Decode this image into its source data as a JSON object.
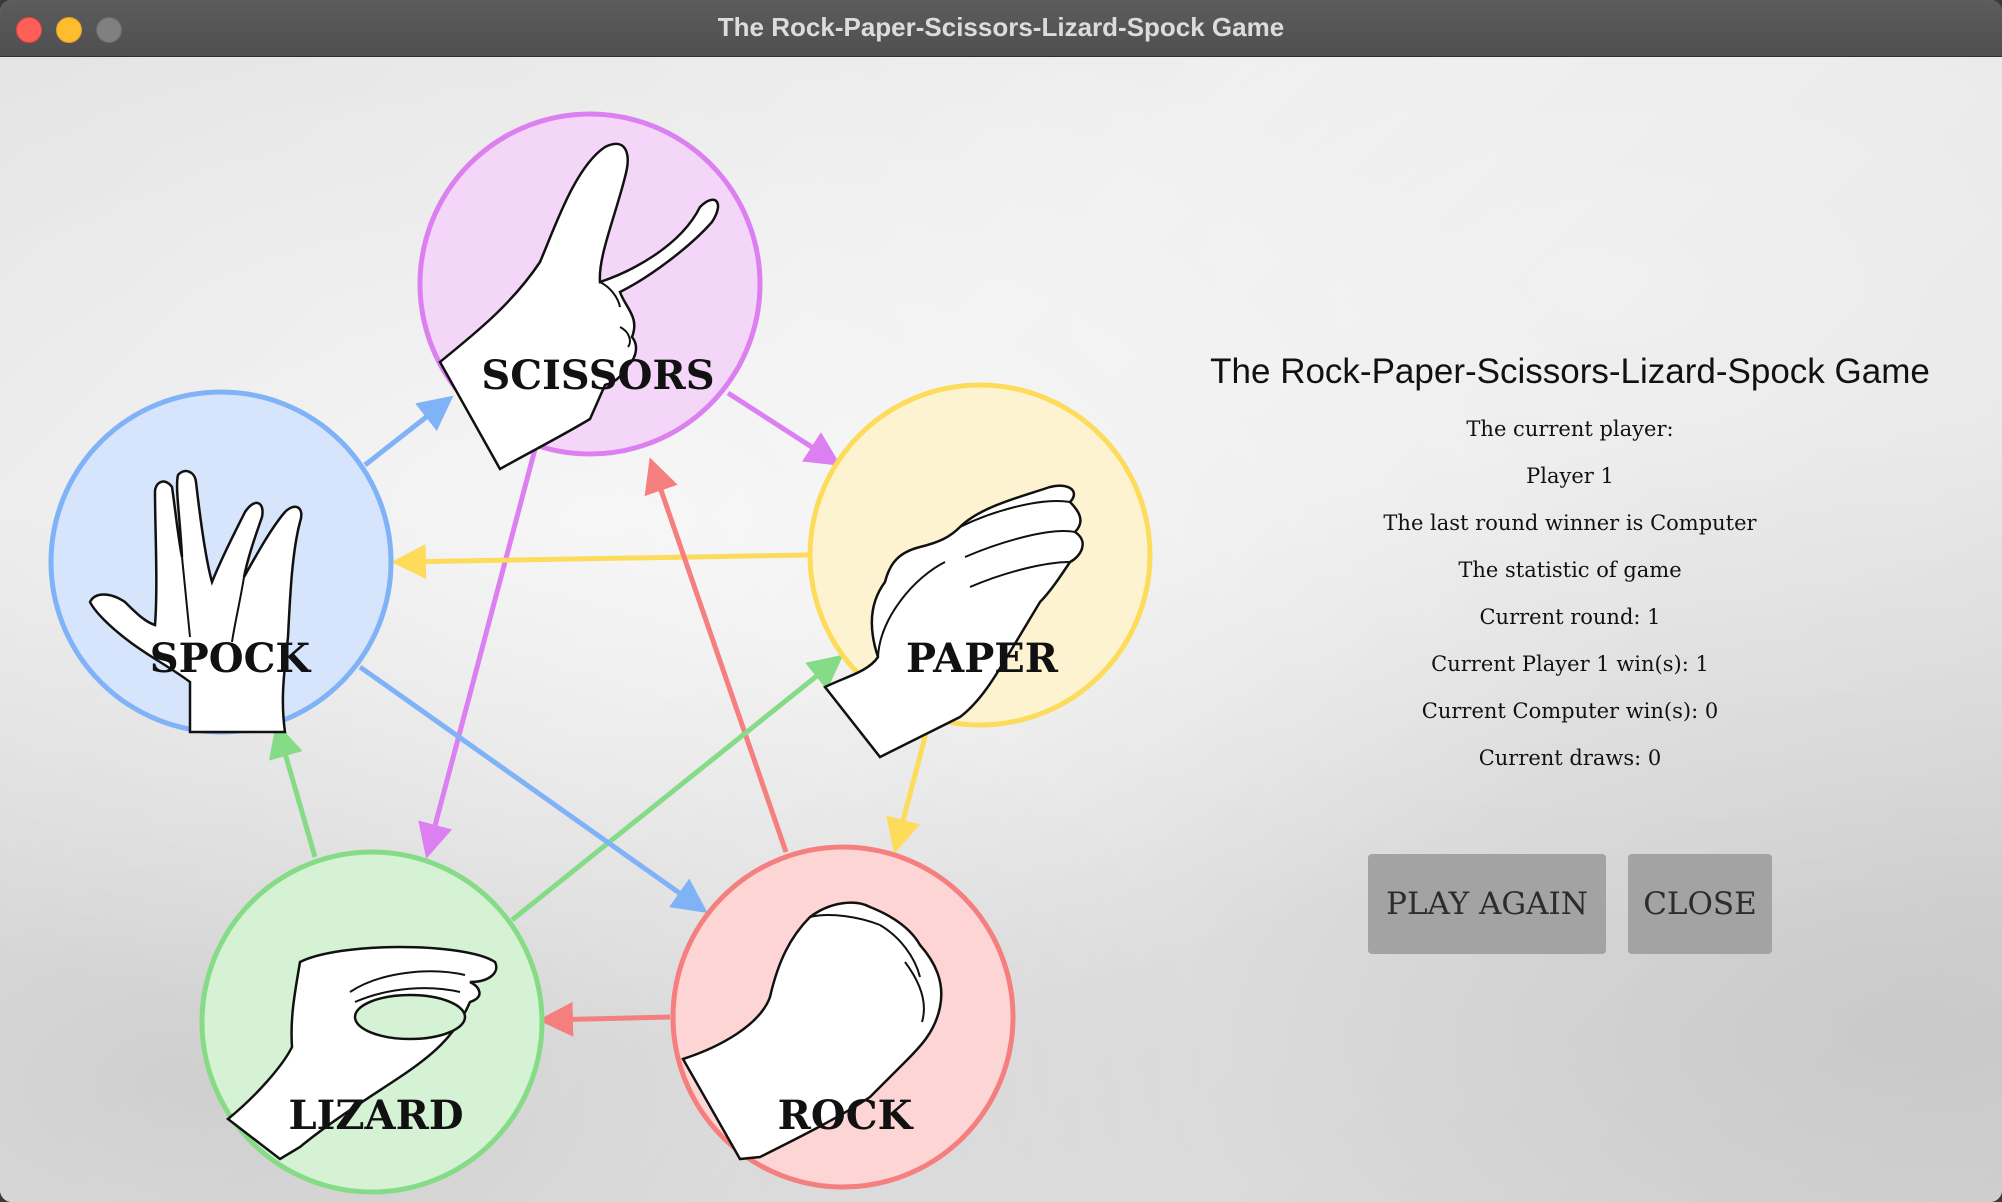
{
  "window": {
    "title": "The Rock-Paper-Scissors-Lizard-Spock Game"
  },
  "gestures": {
    "scissors": {
      "label": "SCISSORS",
      "color": "#dc7ff0",
      "fill": "#f4d6f9",
      "icon": "scissors-hand-icon"
    },
    "paper": {
      "label": "PAPER",
      "color": "#fddb5b",
      "fill": "#fdf3d1",
      "icon": "paper-hand-icon"
    },
    "rock": {
      "label": "ROCK",
      "color": "#f57f7f",
      "fill": "#fdd5d5",
      "icon": "rock-fist-icon"
    },
    "lizard": {
      "label": "LIZARD",
      "color": "#86db86",
      "fill": "#d5f2d5",
      "icon": "lizard-hand-icon"
    },
    "spock": {
      "label": "SPOCK",
      "color": "#7fb2f7",
      "fill": "#d6e5fb",
      "icon": "spock-hand-icon"
    }
  },
  "info": {
    "title": "The Rock-Paper-Scissors-Lizard-Spock Game",
    "current_player_label": "The current player:",
    "current_player": "Player 1",
    "last_winner": "The last round winner is Computer",
    "statistic_label": "The statistic of game",
    "current_round": "Current round: 1",
    "player_wins": "Current Player 1 win(s): 1",
    "computer_wins": "Current Computer win(s): 0",
    "draws": "Current draws: 0"
  },
  "buttons": {
    "play_again": "PLAY AGAIN",
    "close": "CLOSE"
  }
}
